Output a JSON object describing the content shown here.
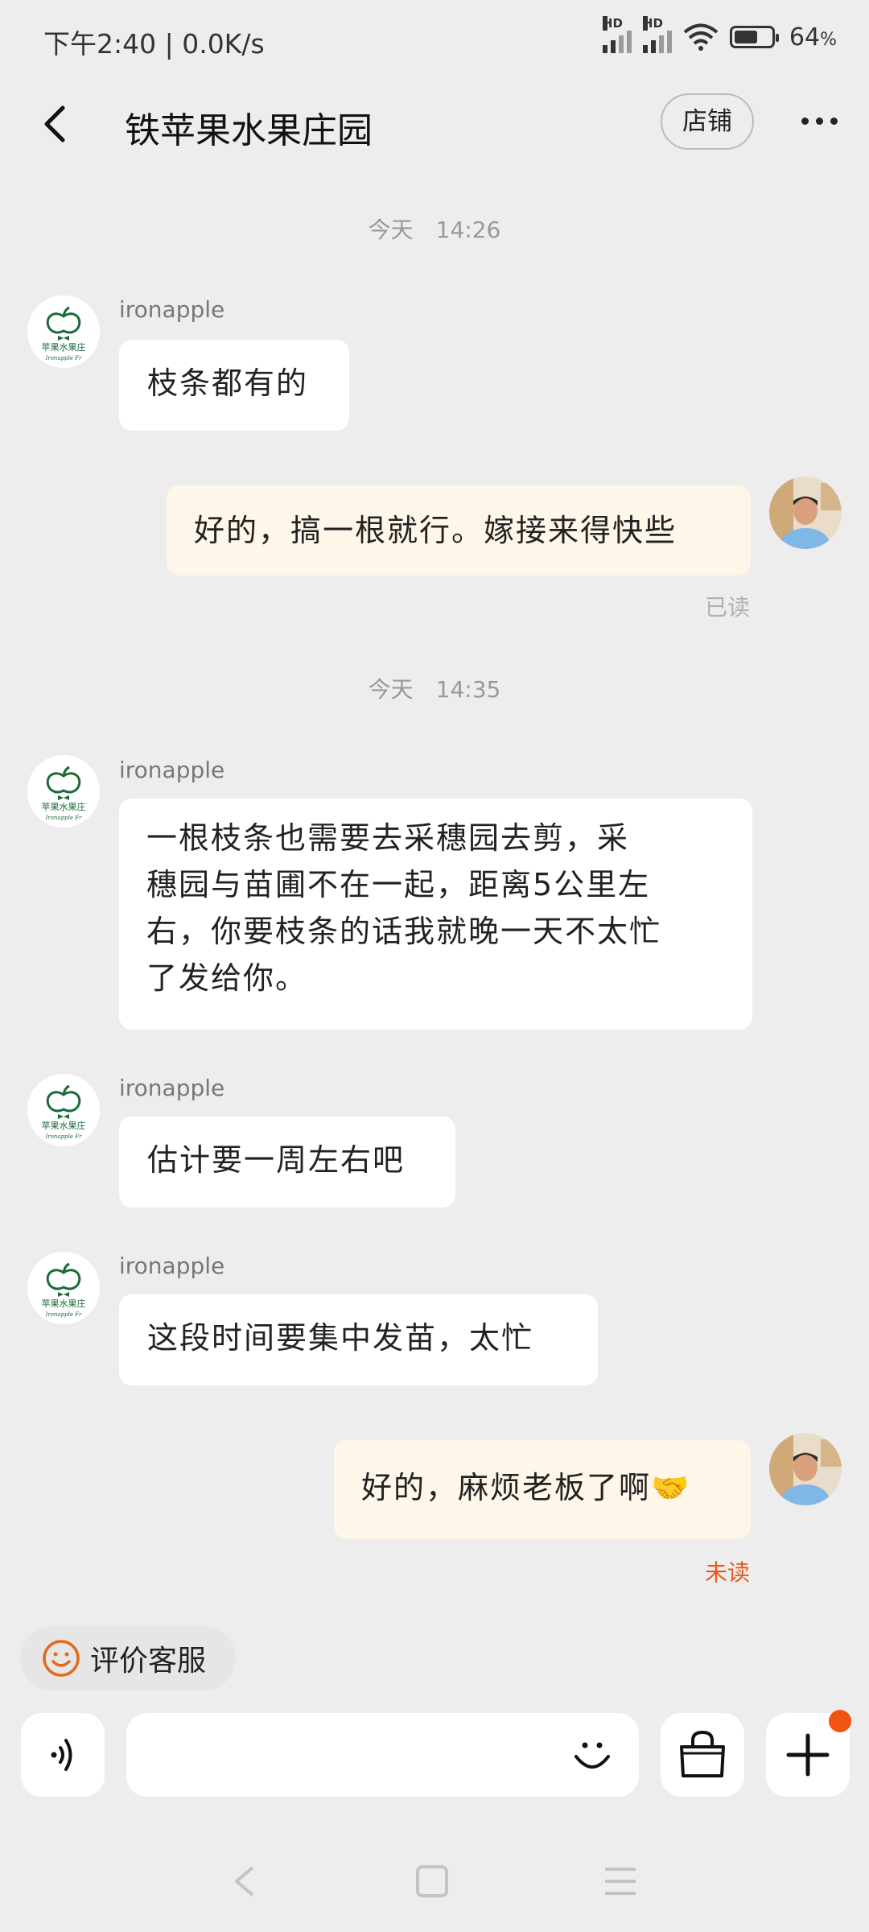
{
  "status_bar": {
    "time": "下午2:40 | 0.0K/s",
    "battery": "64",
    "battery_unit": "%",
    "battery_level": 0.64
  },
  "header": {
    "title": "铁苹果水果庄园",
    "shop_button": "店铺",
    "back_icon": "chevron-left-icon",
    "more_icon": "more-dots-icon"
  },
  "messages": [
    {
      "type": "timestamp",
      "text": "今天　14:26"
    },
    {
      "type": "in",
      "sender": "ironapple",
      "text": "枝条都有的"
    },
    {
      "type": "out",
      "text": "好的，搞一根就行。嫁接来得快些",
      "status": "已读"
    },
    {
      "type": "timestamp",
      "text": "今天　14:35"
    },
    {
      "type": "in",
      "sender": "ironapple",
      "lines": [
        "一根枝条也需要去采穗园去剪，采",
        "穗园与苗圃不在一起，距离5公里左",
        "右，你要枝条的话我就晚一天不太忙",
        "了发给你。"
      ]
    },
    {
      "type": "in",
      "sender": "ironapple",
      "text": "估计要一周左右吧"
    },
    {
      "type": "in",
      "sender": "ironapple",
      "text": "这段时间要集中发苗，太忙"
    },
    {
      "type": "out",
      "text": "好的，麻烦老板了啊",
      "emoji": "🤝",
      "status": "未读"
    }
  ],
  "avatar_logo": {
    "text": "苹果水果庄",
    "script": "Ironapple Fr"
  },
  "evaluate_button": {
    "label": "评价客服"
  },
  "input_bar": {
    "voice_icon": "voice-icon",
    "emoji_icon": "smile-icon",
    "shop_bag_icon": "bag-icon",
    "plus_icon": "plus-icon"
  },
  "nav_bar": {
    "icons": [
      "back-triangle-icon",
      "home-square-icon",
      "menu-lines-icon"
    ]
  },
  "colors": {
    "outgoing_bubble": "#fdf6e9",
    "unread": "#e55a1b",
    "read": "#b0b0b0",
    "accent_dot": "#f25212"
  }
}
